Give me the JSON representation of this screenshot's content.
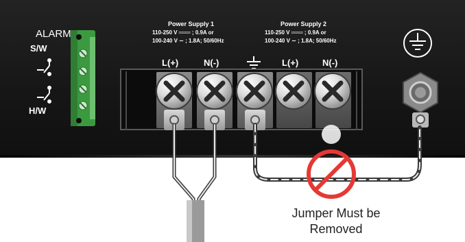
{
  "alarm": {
    "title": "ALARM",
    "sw_label": "S/W",
    "hw_label": "H/W"
  },
  "power_supply_1": {
    "title": "Power Supply 1",
    "spec_dc": "110-250 V  ═══  ; 0.9A or",
    "spec_ac": "100-240 V  ∼  ; 1.8A; 50/60Hz"
  },
  "power_supply_2": {
    "title": "Power Supply 2",
    "spec_dc": "110-250 V  ═══  ; 0.9A or",
    "spec_ac": "100-240 V  ∼  ; 1.8A; 50/60Hz"
  },
  "terminals": [
    {
      "label": "L(+)"
    },
    {
      "label": "N(-)"
    },
    {
      "label": ""
    },
    {
      "label": "L(+)"
    },
    {
      "label": "N(-)"
    }
  ],
  "icons": [
    "earth-ground-symbol-icon",
    "protective-earth-icon",
    "prohibited-icon",
    "relay-contact-icon"
  ],
  "colors": {
    "panel": "#1a1a1a",
    "connector_green": "#4caf50",
    "prohibited_red": "#e53935"
  },
  "caption": {
    "line1": "Jumper Must be",
    "line2": "Removed"
  }
}
